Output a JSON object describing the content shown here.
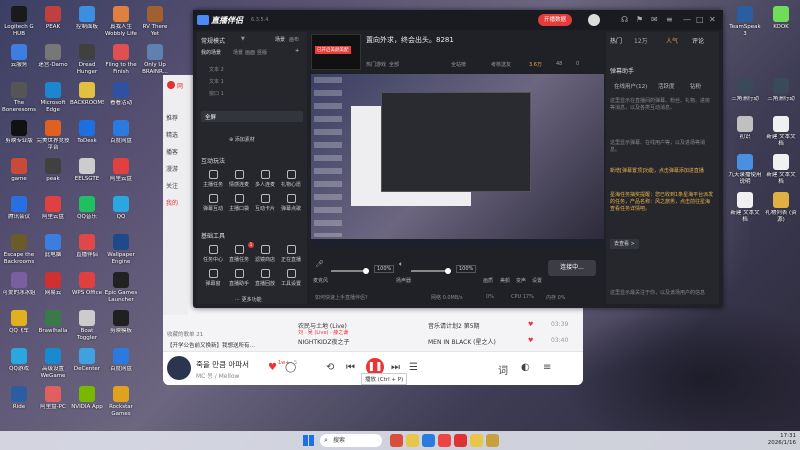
{
  "desktop": {
    "icons": [
      {
        "label": "Logitech G HUB",
        "color": "#1a1a1a"
      },
      {
        "label": "云服务",
        "color": "#3d7ee0"
      },
      {
        "label": "The Boneresoms",
        "color": "#555555"
      },
      {
        "label": "剪映专业版",
        "color": "#111111"
      },
      {
        "label": "game",
        "color": "#c74a3b"
      },
      {
        "label": "腾讯会议",
        "color": "#2a6fe0"
      },
      {
        "label": "Escape the Backrooms",
        "color": "#6b5a2a"
      },
      {
        "label": "可爱的冰冰姐",
        "color": "#7a5fa0"
      },
      {
        "label": "QQ飞车",
        "color": "#e0b020"
      },
      {
        "label": "QQ游戏",
        "color": "#2aa7e0"
      },
      {
        "label": "Ride",
        "color": "#2a5ea0"
      },
      {
        "label": "PEAK",
        "color": "#c04040"
      },
      {
        "label": "迷宫-Damo",
        "color": "#777777"
      },
      {
        "label": "Microsoft Edge",
        "color": "#1d86d0"
      },
      {
        "label": "完美世界竞技平台",
        "color": "#e06020"
      },
      {
        "label": "peak",
        "color": "#404040"
      },
      {
        "label": "阿里云盘",
        "color": "#e04040"
      },
      {
        "label": "此电脑",
        "color": "#3b7ee0"
      },
      {
        "label": "网易云",
        "color": "#d03030"
      },
      {
        "label": "Brawlhalla",
        "color": "#3a7a4a"
      },
      {
        "label": "高级设置 WeGame",
        "color": "#1a8ad0"
      },
      {
        "label": "阿里盘-PC",
        "color": "#e06060"
      },
      {
        "label": "控制面板",
        "color": "#3b8ee0"
      },
      {
        "label": "Dread Hunger",
        "color": "#404040"
      },
      {
        "label": "BACKROOMS",
        "color": "#e0c040"
      },
      {
        "label": "ToDesk",
        "color": "#1e6fe0"
      },
      {
        "label": "EELSGTE",
        "color": "#cccccc"
      },
      {
        "label": "QQ音乐",
        "color": "#20c060"
      },
      {
        "label": "直播伴侣",
        "color": "#e04848"
      },
      {
        "label": "WPS Office",
        "color": "#e04040"
      },
      {
        "label": "Boat Toggler",
        "color": "#cccccc"
      },
      {
        "label": "DeCenter",
        "color": "#40a0e0"
      },
      {
        "label": "NVIDIA App",
        "color": "#76b900"
      },
      {
        "label": "真我人生 Wobbly Life",
        "color": "#e08040"
      },
      {
        "label": "Fling to the Finish",
        "color": "#e05050"
      },
      {
        "label": "看看活动",
        "color": "#3050a0"
      },
      {
        "label": "百度网盘",
        "color": "#2a7ae0"
      },
      {
        "label": "阿里云盘",
        "color": "#e04040"
      },
      {
        "label": "QQ",
        "color": "#2aa7e0"
      },
      {
        "label": "Wallpaper Engine",
        "color": "#1e4a8a"
      },
      {
        "label": "Epic Games Launcher",
        "color": "#222222"
      },
      {
        "label": "剪映模板",
        "color": "#202020"
      },
      {
        "label": "百度网盘",
        "color": "#2a7ae0"
      },
      {
        "label": "Rockstar Games",
        "color": "#e0a020"
      },
      {
        "label": "RV There Yet",
        "color": "#a06030"
      },
      {
        "label": "Only Up BRAINR...",
        "color": "#6080b0"
      }
    ],
    "right_icons": [
      {
        "label": "TeamSpeak 3",
        "color": "#2a5ea0"
      },
      {
        "label": "KOOK",
        "color": "#6fdc5a"
      },
      {
        "label": "三角洲行动",
        "color": "#3a4a5a"
      },
      {
        "label": "三角洲行动",
        "color": "#3a4a5a"
      },
      {
        "label": "初识",
        "color": "#c0c0c0"
      },
      {
        "label": "新建 文本文档",
        "color": "#f0f0f0"
      },
      {
        "label": "九天录播使用说明",
        "color": "#4a90e0"
      },
      {
        "label": "新建 文本文档",
        "color": "#f0f0f0"
      },
      {
        "label": "新建 文本文档",
        "color": "#f0f0f0"
      },
      {
        "label": "礼物列表 (资源)",
        "color": "#e0b040"
      }
    ]
  },
  "music_app": {
    "logo": "网",
    "sidebar_items": [
      "推荐",
      "精选",
      "播客",
      "漫游",
      "关注",
      "我的"
    ],
    "section_label": "收藏的歌单 21",
    "banner_text": "【开学公告前又换新】我想送所有…",
    "tracks": [
      {
        "title": "农民与土地 (Live)",
        "artist": "刘 · 吴 (Live) · 薛之谦",
        "album": "音乐请计划2 第5期",
        "duration": "03:39"
      },
      {
        "title": "NIGHTKIDZ夜之子",
        "artist": "",
        "album": "MEN IN BLACK (星之人)",
        "duration": "03:40"
      }
    ],
    "now_playing": {
      "title": "죽을 만큼 아파서",
      "artist": "MC 몽 / Mellow",
      "likes": "1w+",
      "comments": "5"
    },
    "tooltip": "播放 (Ctrl + P)"
  },
  "live_app": {
    "title": "直播伴侣",
    "version": "6.3.5.4",
    "live_button": "开播数据",
    "mode_label": "常规模式",
    "top_tabs": [
      "场景",
      "画布"
    ],
    "scene_header": "我的场景",
    "scene_sub_tabs": [
      "场景",
      "画面",
      "竖版"
    ],
    "scenes": [
      "文本 2",
      "文本 1",
      "窗口 1"
    ],
    "scene_selected": "全屏",
    "add_material": "添加素材",
    "interact_section": "互动玩法",
    "interact_tools": [
      "主播任务",
      "情感连麦",
      "多人连麦",
      "礼物心愿",
      "弹幕互动",
      "主播口袋",
      "互动卡片",
      "弹幕点歌"
    ],
    "basic_section": "基础工具",
    "basic_tools": [
      "任务中心",
      "直播任务",
      "滤镜商店",
      "正在直播",
      "弹幕窗",
      "直播助手",
      "直播回放",
      "工具设置"
    ],
    "more_label": "更多功能",
    "basic_badge": "1",
    "room_title": "置向外求，终会出头。8281",
    "room_thumb_tag": "已开启美颜美配",
    "room_stats": [
      "热门游戏",
      "全部",
      "全站榜",
      "考核送友",
      "3.6万",
      "48",
      "0"
    ],
    "audio": {
      "mic_label": "麦克风",
      "mic_pct": "100%",
      "desktop_label": "扬声器",
      "desktop_pct": "100%",
      "icons": [
        "画质",
        "美颜",
        "变声",
        "设置"
      ],
      "connect": "连接中..."
    },
    "status": {
      "text": "如何快速上手直播伴侣?",
      "network": "网络 0.0MB/s",
      "bitrate": "0%",
      "cpu": "CPU 17%",
      "mem": "内存 0%"
    },
    "right_panel": {
      "tabs": [
        "热门",
        "12万",
        "人气",
        "评论"
      ],
      "assistant_title": "弹幕助手",
      "sub_tabs": [
        "在线用户(12)",
        "活跃度",
        "钻粉"
      ],
      "msg1": "这里显示在直播间的弹幕、粉丝、礼物、进房等消息，以及各类互动消息。",
      "msg2": "这里显示弹幕、在线用户等，以及进场等消息。",
      "highlight1": "新增[弹幕置顶]功能，点击弹幕添加进直播",
      "highlight2": "星海任务抽奖提醒：您已收到1条星海平台派发的任务，产品名称：风之旅男，点击前往星海查看任务详情吧。",
      "view_btn": "去查看 >",
      "footer": "这里显示最关注于你，以及该场用户的信息"
    }
  },
  "taskbar": {
    "search_placeholder": "搜索",
    "time": "17:31",
    "date": "2026/1/16"
  }
}
